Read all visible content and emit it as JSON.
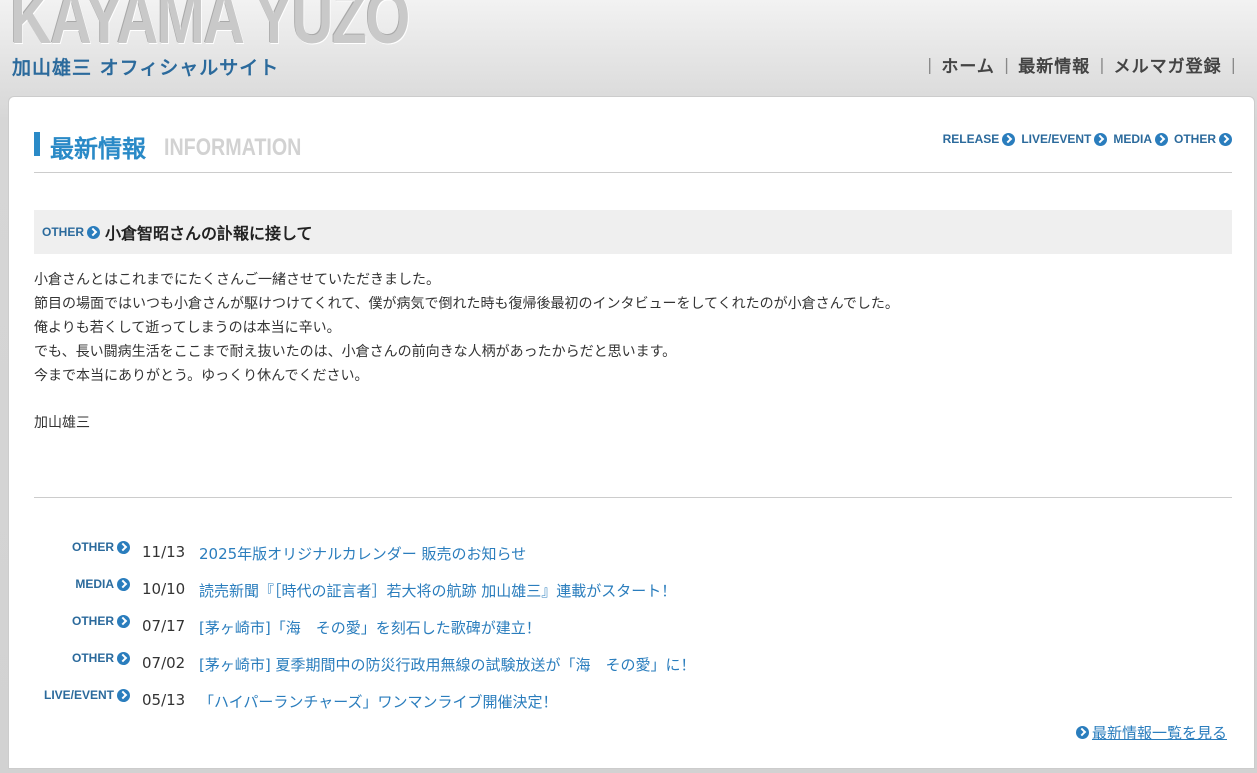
{
  "header": {
    "logo_text": "KAYAMA YUZO",
    "subtitle": "加山雄三 オフィシャルサイト",
    "nav": [
      {
        "label": "ホーム"
      },
      {
        "label": "最新情報"
      },
      {
        "label": "メルマガ登録"
      }
    ]
  },
  "section": {
    "title": "最新情報",
    "subtitle": "INFORMATION",
    "categories": [
      {
        "label": "RELEASE"
      },
      {
        "label": "LIVE/EVENT"
      },
      {
        "label": "MEDIA"
      },
      {
        "label": "OTHER"
      }
    ]
  },
  "article": {
    "category": "OTHER",
    "title": "小倉智昭さんの訃報に接して",
    "body": [
      "小倉さんとはこれまでにたくさんご一緒させていただきました。",
      "節目の場面ではいつも小倉さんが駆けつけてくれて、僕が病気で倒れた時も復帰後最初のインタビューをしてくれたのが小倉さんでした。",
      "俺よりも若くして逝ってしまうのは本当に辛い。",
      "でも、長い闘病生活をここまで耐え抜いたのは、小倉さんの前向きな人柄があったからだと思います。",
      "今まで本当にありがとう。ゆっくり休んでください。"
    ],
    "signature": "加山雄三"
  },
  "news": [
    {
      "category": "OTHER",
      "date": "11/13",
      "title": "2025年版オリジナルカレンダー 販売のお知らせ"
    },
    {
      "category": "MEDIA",
      "date": "10/10",
      "title": "読売新聞『［時代の証言者］若大将の航跡 加山雄三』連載がスタート！"
    },
    {
      "category": "OTHER",
      "date": "07/17",
      "title": "[茅ヶ崎市]「海　その愛」を刻石した歌碑が建立！"
    },
    {
      "category": "OTHER",
      "date": "07/02",
      "title": "[茅ヶ崎市] 夏季期間中の防災行政用無線の試験放送が「海　その愛」に！"
    },
    {
      "category": "LIVE/EVENT",
      "date": "05/13",
      "title": "「ハイパーランチャーズ」ワンマンライブ開催決定！"
    }
  ],
  "more_link": "最新情報一覧を見る",
  "colors": {
    "accent": "#2a8ac7",
    "link": "#2a7dbd",
    "nav_text": "#444444"
  }
}
